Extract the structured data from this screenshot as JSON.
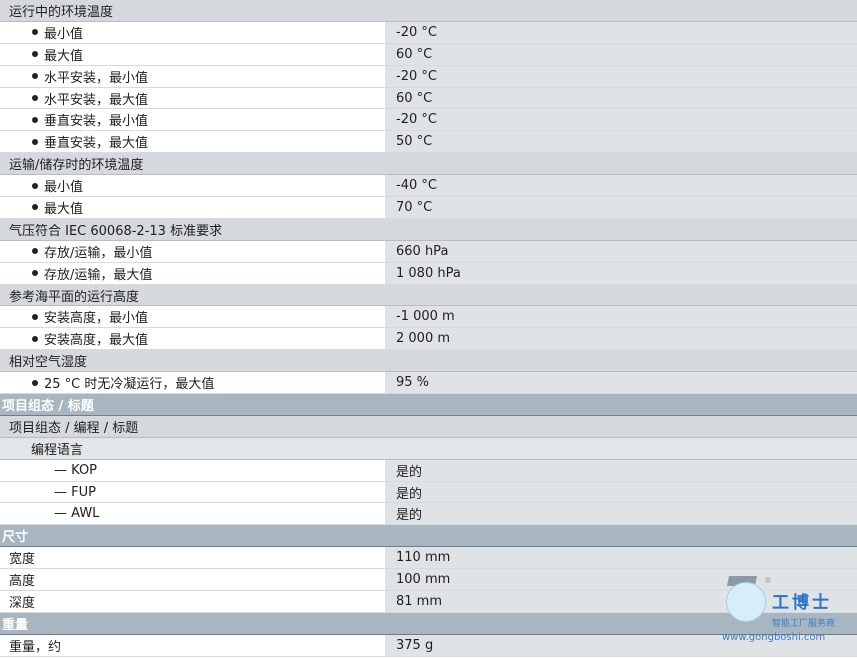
{
  "sections": {
    "env_op": {
      "title": "运行中的环境温度",
      "rows": [
        {
          "label": "最小值",
          "value": "-20 °C"
        },
        {
          "label": "最大值",
          "value": "60 °C"
        },
        {
          "label": "水平安装，最小值",
          "value": "-20 °C"
        },
        {
          "label": "水平安装，最大值",
          "value": "60 °C"
        },
        {
          "label": "垂直安装，最小值",
          "value": "-20 °C"
        },
        {
          "label": "垂直安装，最大值",
          "value": "50 °C"
        }
      ]
    },
    "env_store": {
      "title": "运输/储存时的环境温度",
      "rows": [
        {
          "label": "最小值",
          "value": "-40 °C"
        },
        {
          "label": "最大值",
          "value": "70 °C"
        }
      ]
    },
    "pressure": {
      "title": "气压符合 IEC 60068-2-13 标准要求",
      "rows": [
        {
          "label": "存放/运输，最小值",
          "value": "660 hPa"
        },
        {
          "label": "存放/运输，最大值",
          "value": "1 080 hPa"
        }
      ]
    },
    "altitude": {
      "title": "参考海平面的运行高度",
      "rows": [
        {
          "label": "安装高度，最小值",
          "value": "-1 000 m"
        },
        {
          "label": "安装高度，最大值",
          "value": "2 000 m"
        }
      ]
    },
    "humidity": {
      "title": "相对空气湿度",
      "rows": [
        {
          "label": "25 °C 时无冷凝运行，最大值",
          "value": "95 %"
        }
      ]
    }
  },
  "project": {
    "header": "项目组态 / 标题",
    "group": "项目组态 / 编程 / 标题",
    "subgroup": "编程语言",
    "rows": [
      {
        "label": "— KOP",
        "value": "是的"
      },
      {
        "label": "— FUP",
        "value": "是的"
      },
      {
        "label": "— AWL",
        "value": "是的"
      }
    ]
  },
  "dimensions": {
    "header": "尺寸",
    "rows": [
      {
        "label": "宽度",
        "value": "110 mm"
      },
      {
        "label": "高度",
        "value": "100 mm"
      },
      {
        "label": "深度",
        "value": "81 mm"
      }
    ]
  },
  "weight": {
    "header": "重量",
    "rows": [
      {
        "label": "重量，约",
        "value": "375 g"
      }
    ]
  },
  "watermark": {
    "title": "工博士",
    "subtitle": "智能工厂服务商",
    "url": "www.gongboshi.com",
    "reg": "®"
  }
}
